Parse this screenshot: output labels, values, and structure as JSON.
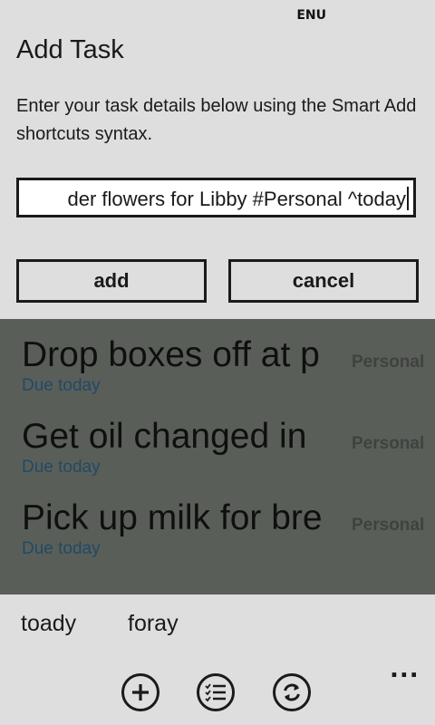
{
  "status_bar": {
    "language": "ENU"
  },
  "dialog": {
    "title": "Add Task",
    "instructions": "Enter your task details below using the Smart Add shortcuts syntax.",
    "input_value": "der flowers for Libby #Personal ^today",
    "add_label": "add",
    "cancel_label": "cancel"
  },
  "tasks": [
    {
      "title": "Drop boxes off at p",
      "due": "Due today",
      "tag": "Personal"
    },
    {
      "title": "Get oil changed in",
      "due": "Due today",
      "tag": "Personal"
    },
    {
      "title": "Pick up milk for bre",
      "due": "Due today",
      "tag": "Personal"
    }
  ],
  "suggestions": [
    "toady",
    "foray"
  ],
  "app_bar": {
    "buttons": [
      "add-icon",
      "list-icon",
      "sync-icon"
    ],
    "more": "..."
  },
  "colors": {
    "background": "#dedede",
    "overlay": "#5a5e59",
    "due_text": "#204a66",
    "text": "#1a1a1a"
  }
}
